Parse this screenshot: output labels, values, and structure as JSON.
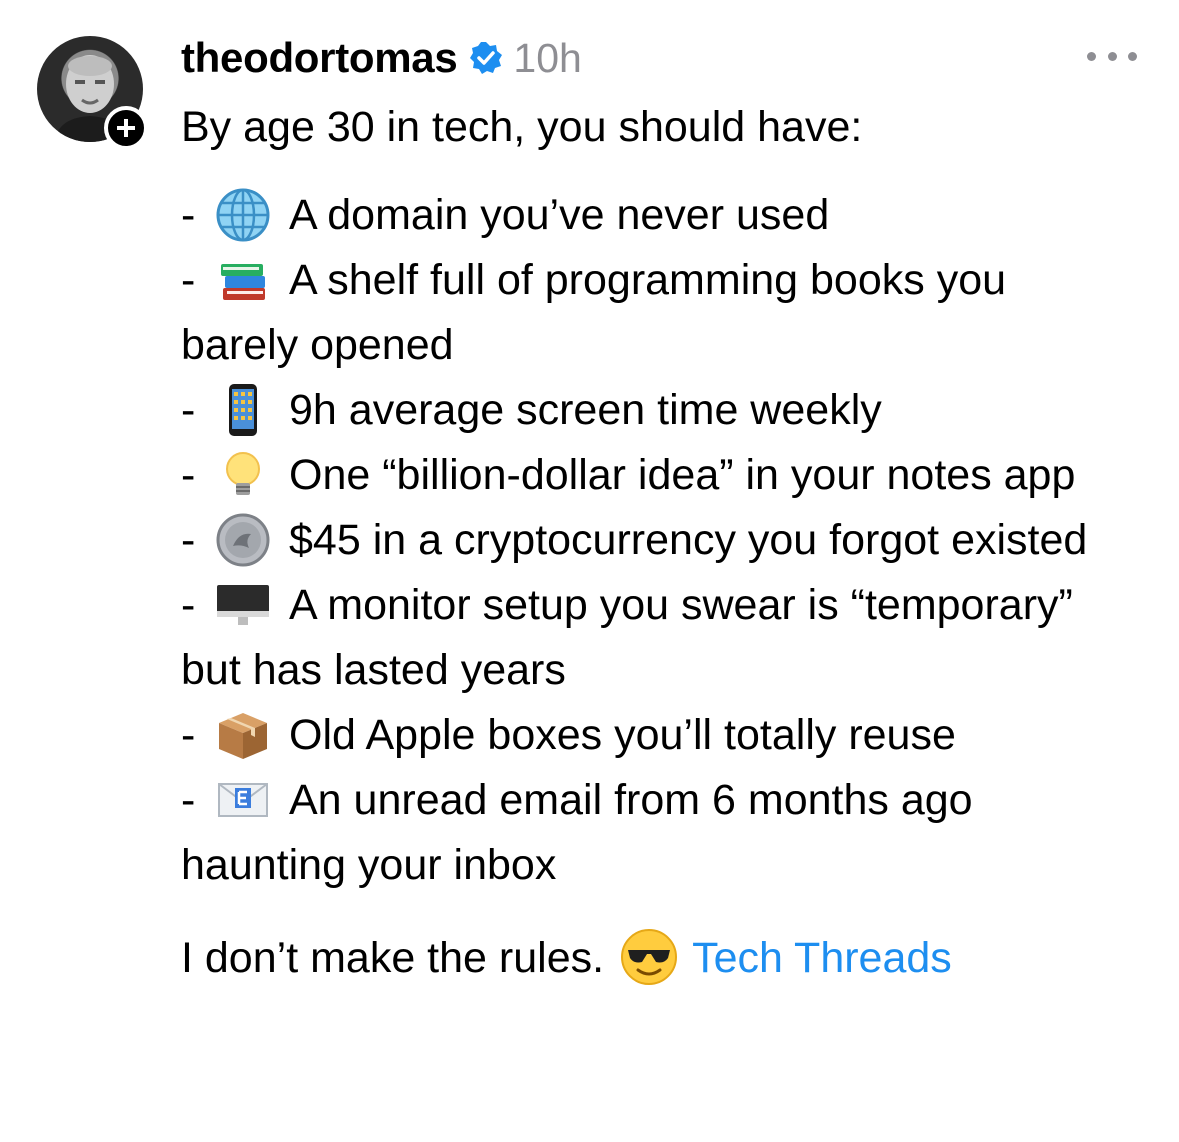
{
  "author": {
    "username": "theodortomas",
    "time_ago": "10h",
    "avatar_icon": "profile-photo",
    "verified_icon": "verified-badge-icon",
    "verified_color": "#1d8ef0"
  },
  "post": {
    "intro": "By age 30 in tech, you should have:",
    "items": [
      {
        "dash": "-",
        "icon": "globe-icon",
        "text": "A domain you’ve never used"
      },
      {
        "dash": "-",
        "icon": "books-icon",
        "text": "A shelf full of programming books you barely opened"
      },
      {
        "dash": "-",
        "icon": "phone-icon",
        "text": "9h average screen time weekly"
      },
      {
        "dash": "-",
        "icon": "lightbulb-icon",
        "text": "One “billion-dollar idea” in your notes app"
      },
      {
        "dash": "-",
        "icon": "coin-icon",
        "text": "$45 in a cryptocurrency you forgot existed"
      },
      {
        "dash": "-",
        "icon": "monitor-icon",
        "text": "A monitor setup you swear is “temporary” but has lasted years"
      },
      {
        "dash": "-",
        "icon": "package-icon",
        "text": "Old Apple boxes you’ll totally reuse"
      },
      {
        "dash": "-",
        "icon": "email-icon",
        "text": "An unread email from 6 months ago haunting your inbox"
      }
    ],
    "closing": "I don’t make the rules.",
    "closing_icon": "sunglasses-face-icon",
    "link_text": "Tech Threads",
    "link_color": "#1d8ef0"
  }
}
